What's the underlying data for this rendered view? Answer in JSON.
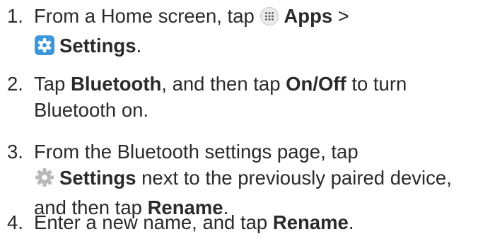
{
  "steps": [
    {
      "number": "1.",
      "lines": [
        {
          "text_before": "From a Home screen, tap",
          "icon": "apps-grid-icon",
          "bold": "Apps",
          "text_after": " >"
        },
        {
          "icon": "settings-gear-blue-icon",
          "bold": "Settings",
          "text_after": "."
        }
      ]
    },
    {
      "number": "2.",
      "lines": [
        {
          "text_before": "Tap ",
          "bold": "Bluetooth",
          "text_mid": ", and then tap ",
          "bold2": "On/Off",
          "text_after": " to turn"
        },
        {
          "text_before": "Bluetooth on."
        }
      ]
    },
    {
      "number": "3.",
      "lines": [
        {
          "text_before": "From the Bluetooth settings page, tap"
        },
        {
          "icon": "settings-gear-gray-icon",
          "bold": "Settings",
          "text_after": " next to the previously paired device,"
        },
        {
          "text_before": "and then tap ",
          "bold": "Rename",
          "text_after": "."
        }
      ]
    },
    {
      "number": "4.",
      "lines": [
        {
          "text_before": "Enter a new name, and tap ",
          "bold": "Rename",
          "text_after": "."
        }
      ]
    }
  ],
  "colors": {
    "text": "#2a2a2a",
    "settings_icon_blue": "#3c97da",
    "settings_icon_gray": "#b9b9b9",
    "apps_icon_bg": "#ececec"
  }
}
